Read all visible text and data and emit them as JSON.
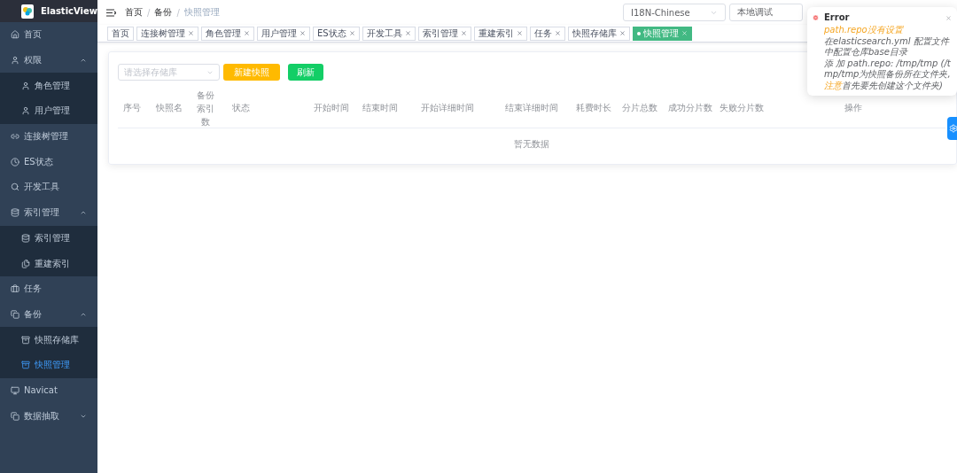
{
  "app": {
    "name": "ElasticView"
  },
  "sidebar": {
    "items": [
      {
        "label": "首页",
        "selected": false
      },
      {
        "label": "权限",
        "selected": false,
        "expanded": true,
        "children": [
          {
            "label": "角色管理",
            "selected": false
          },
          {
            "label": "用户管理",
            "selected": false
          }
        ]
      },
      {
        "label": "连接树管理",
        "selected": false
      },
      {
        "label": "ES状态",
        "selected": false
      },
      {
        "label": "开发工具",
        "selected": false
      },
      {
        "label": "索引管理",
        "selected": false,
        "expanded": true,
        "children": [
          {
            "label": "索引管理",
            "selected": false
          },
          {
            "label": "重建索引",
            "selected": false
          }
        ]
      },
      {
        "label": "任务",
        "selected": false
      },
      {
        "label": "备份",
        "selected": false,
        "expanded": true,
        "children": [
          {
            "label": "快照存储库",
            "selected": false
          },
          {
            "label": "快照管理",
            "selected": true
          }
        ]
      },
      {
        "label": "Navicat",
        "selected": false
      },
      {
        "label": "数据抽取",
        "selected": false,
        "expanded": false
      }
    ]
  },
  "breadcrumb": {
    "items": [
      "首页",
      "备份",
      "快照管理"
    ],
    "separators": [
      "/",
      "/"
    ]
  },
  "header": {
    "language_select": "I18N-Chinese",
    "connection_select": "本地调试"
  },
  "tabs": [
    {
      "label": "首页",
      "selected": false,
      "closable": false
    },
    {
      "label": "连接树管理",
      "selected": false,
      "closable": true
    },
    {
      "label": "角色管理",
      "selected": false,
      "closable": true
    },
    {
      "label": "用户管理",
      "selected": false,
      "closable": true
    },
    {
      "label": "ES状态",
      "selected": false,
      "closable": true
    },
    {
      "label": "开发工具",
      "selected": false,
      "closable": true
    },
    {
      "label": "索引管理",
      "selected": false,
      "closable": true
    },
    {
      "label": "重建索引",
      "selected": false,
      "closable": true
    },
    {
      "label": "任务",
      "selected": false,
      "closable": true
    },
    {
      "label": "快照存储库",
      "selected": false,
      "closable": true
    },
    {
      "label": "快照管理",
      "selected": true,
      "closable": true
    }
  ],
  "toolbar": {
    "repository_select": {
      "placeholder": "请选择存储库"
    },
    "buttons": [
      {
        "label": "新建快照",
        "kind": "warning"
      },
      {
        "label": "刷新",
        "kind": "success"
      }
    ]
  },
  "table": {
    "columns": [
      "序号",
      "快照名",
      "备份索引数",
      "状态",
      "开始时间",
      "结束时间",
      "开始详细时间",
      "结束详细时间",
      "耗费时长",
      "分片总数",
      "成功分片数",
      "失败分片数",
      "操作"
    ],
    "empty_text": "暂无数据"
  },
  "notification": {
    "title": "Error",
    "lines": [
      {
        "highlight": "path.repo没有设置"
      },
      {
        "text": "在elasticsearch.yml 配置文件中配置仓库base目录"
      },
      {
        "text": "添 加 path.repo:  /tmp/tmp  (/tmp/tmp为快照备份所在文件夹,"
      },
      {
        "highlight": "注意",
        "text": "首先要先创建这个文件夹)"
      }
    ]
  }
}
